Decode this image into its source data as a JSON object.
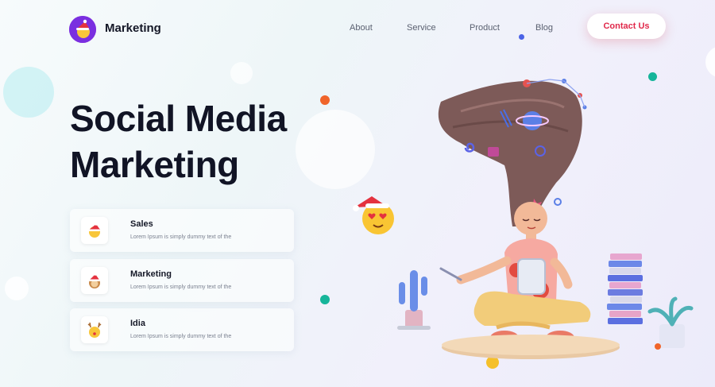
{
  "brand": {
    "name": "Marketing"
  },
  "nav": {
    "links": [
      {
        "label": "About"
      },
      {
        "label": "Service"
      },
      {
        "label": "Product"
      },
      {
        "label": "Blog"
      }
    ],
    "contact_label": "Contact Us"
  },
  "hero": {
    "title_line1": "Social Media",
    "title_line2": "Marketing"
  },
  "cards": [
    {
      "title": "Sales",
      "text": "Lorem Ipsum is simply dummy text of the",
      "icon": "santa-emoji-icon"
    },
    {
      "title": "Marketing",
      "text": "Lorem Ipsum is simply dummy text of the",
      "icon": "monkey-santa-emoji-icon"
    },
    {
      "title": "Idia",
      "text": "Lorem Ipsum is simply dummy text of the",
      "icon": "reindeer-emoji-icon"
    }
  ],
  "colors": {
    "accent_red": "#e0284a",
    "brand_purple": "#7a2fe0",
    "text_dark": "#111425",
    "dot_orange": "#f0642a",
    "dot_teal": "#16b59a",
    "dot_blue": "#4b63e6"
  }
}
